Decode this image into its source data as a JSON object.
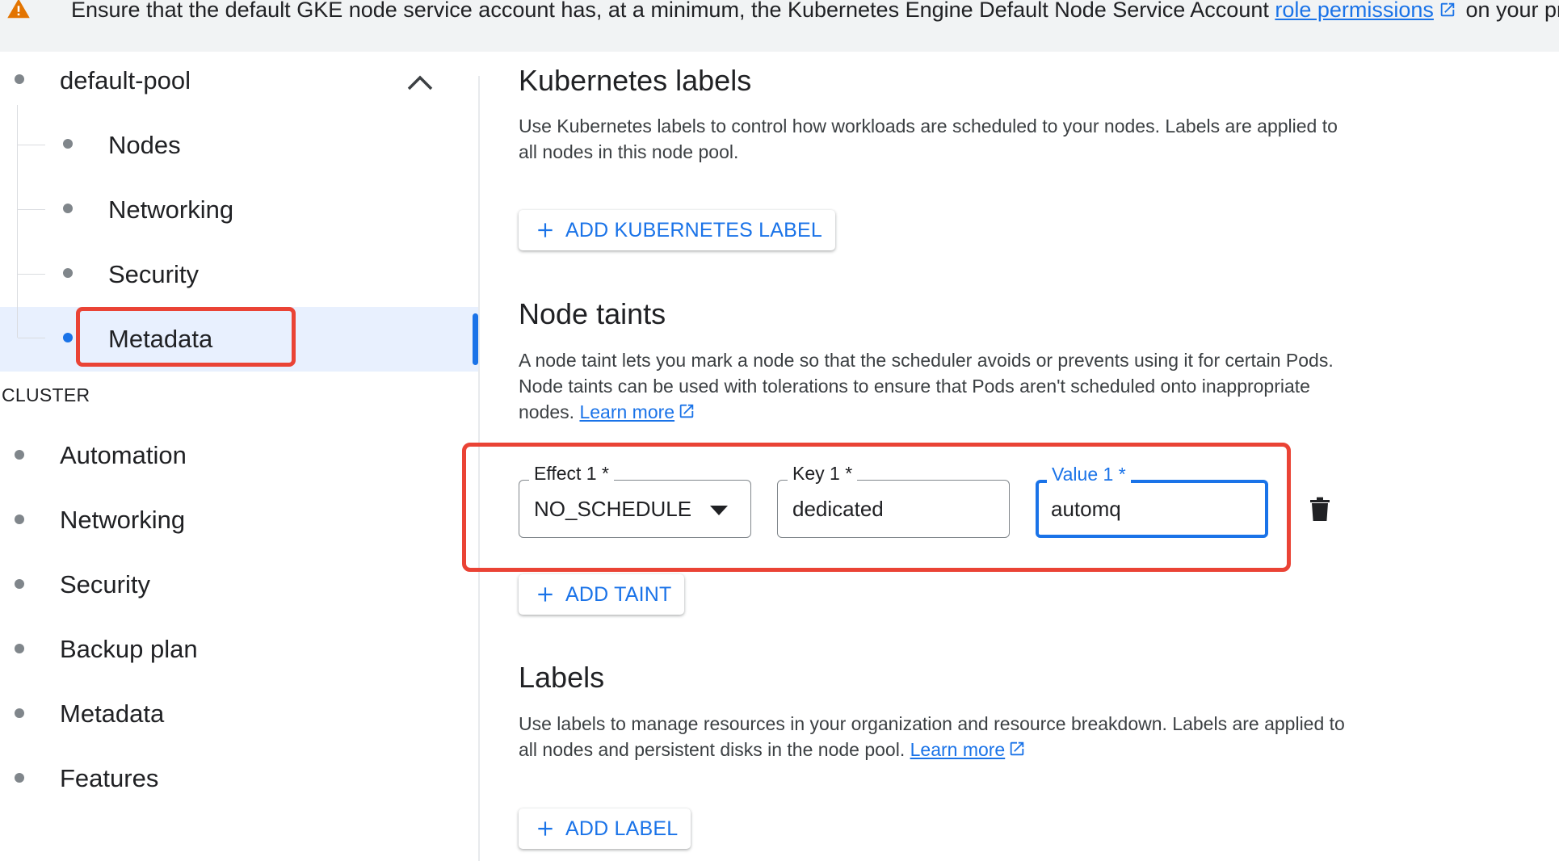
{
  "banner": {
    "text_before": "Ensure that the default GKE node service account has, at a minimum, the Kubernetes Engine Default Node Service Account ",
    "link": "role permissions",
    "text_after": " on your project.",
    "icon": "warning-icon"
  },
  "sidebar": {
    "node_pool": "default-pool",
    "node_pool_items": [
      {
        "label": "Nodes"
      },
      {
        "label": "Networking"
      },
      {
        "label": "Security"
      },
      {
        "label": "Metadata",
        "active": true
      }
    ],
    "cluster_heading": "CLUSTER",
    "cluster_items": [
      {
        "label": "Automation"
      },
      {
        "label": "Networking"
      },
      {
        "label": "Security"
      },
      {
        "label": "Backup plan"
      },
      {
        "label": "Metadata"
      },
      {
        "label": "Features"
      }
    ]
  },
  "main": {
    "k8s_labels": {
      "title": "Kubernetes labels",
      "description": "Use Kubernetes labels to control how workloads are scheduled to your nodes. Labels are applied to all nodes in this node pool.",
      "button": "ADD KUBERNETES LABEL"
    },
    "node_taints": {
      "title": "Node taints",
      "description": "A node taint lets you mark a node so that the scheduler avoids or prevents using it for certain Pods. Node taints can be used with tolerations to ensure that Pods aren't scheduled onto inappropriate nodes. ",
      "learn_more": "Learn more",
      "effect_label": "Effect 1 *",
      "effect_value": "NO_SCHEDULE",
      "key_label": "Key 1 *",
      "key_value": "dedicated",
      "value_label": "Value 1 *",
      "value_value": "automq",
      "button": "ADD TAINT"
    },
    "labels": {
      "title": "Labels",
      "description": "Use labels to manage resources in your organization and resource breakdown. Labels are applied to all nodes and persistent disks in the node pool. ",
      "learn_more": "Learn more",
      "button": "ADD LABEL"
    }
  },
  "colors": {
    "accent": "#1a73e8",
    "highlight": "#ea4335",
    "warning": "#e37400"
  }
}
